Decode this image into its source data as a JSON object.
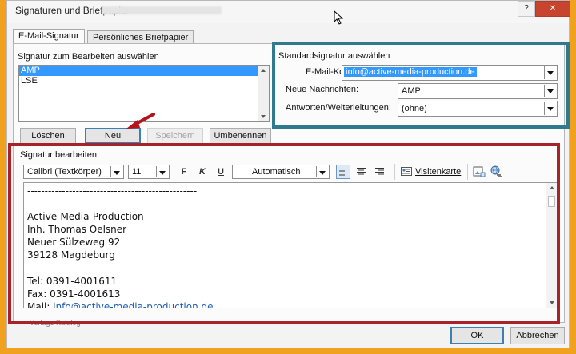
{
  "window": {
    "title": "Signaturen und Briefpapier",
    "help": "?",
    "close": "✕"
  },
  "tabs": [
    {
      "label": "E-Mail-Signatur"
    },
    {
      "label": "Persönliches Briefpapier"
    }
  ],
  "signatures": {
    "section_label": "Signatur zum Bearbeiten auswählen",
    "items": [
      "AMP",
      "LSE"
    ],
    "selected": "AMP",
    "buttons": {
      "delete": "Löschen",
      "new": "Neu",
      "save": "Speichern",
      "rename": "Umbenennen"
    }
  },
  "default_signature": {
    "section_label": "Standardsignatur auswählen",
    "account_label": "E-Mail-Konto:",
    "account_value": "info@active-media-production.de",
    "new_messages_label": "Neue Nachrichten:",
    "new_messages_value": "AMP",
    "replies_label": "Antworten/Weiterleitungen:",
    "replies_value": "(ohne)"
  },
  "editor": {
    "section_label": "Signatur bearbeiten",
    "font": "Calibri (Textkörper)",
    "size": "11",
    "bold": "F",
    "italic": "K",
    "underline": "U",
    "color": "Automatisch",
    "business_card": "Visitenkarte",
    "lines": [
      "-------------------------------------------------",
      "",
      "Active-Media-Production",
      "Inh. Thomas Oelsner",
      "Neuer Sülzeweg 92",
      "39128 Magdeburg",
      "",
      "Tel: 0391-4001611",
      "Fax: 0391-4001613"
    ],
    "mail_prefix": "Mail: ",
    "mail_link": "info@active-media-production.de",
    "template_text": "Vorlage Katalog"
  },
  "footer": {
    "ok": "OK",
    "cancel": "Abbrechen"
  },
  "colors": {
    "frame": "#f0a11e",
    "teal_highlight": "#2f7a8e",
    "red_highlight": "#a9222a",
    "selection": "#3399ff"
  }
}
